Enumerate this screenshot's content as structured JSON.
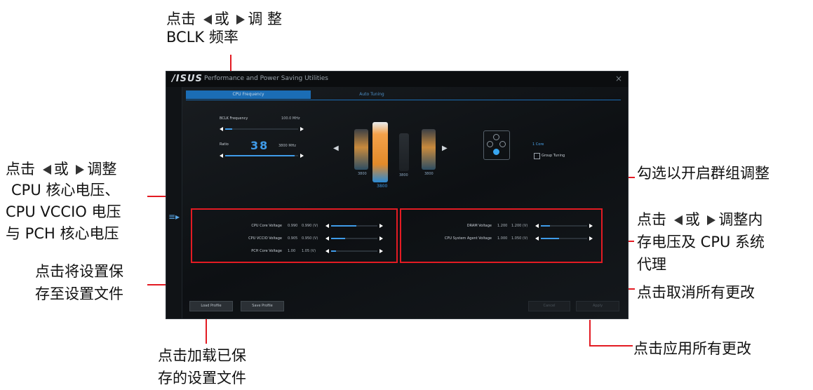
{
  "annotations": {
    "bclk_line1_a": "点击",
    "bclk_line1_b": "或",
    "bclk_line1_c": "调 整",
    "bclk_line2": "BCLK 频率",
    "voltage_line1_a": "点击",
    "voltage_line1_b": "或",
    "voltage_line1_c": "调整",
    "voltage_line2": "CPU 核心电压、",
    "voltage_line3": "CPU VCCIO 电压",
    "voltage_line4": "与 PCH 核心电压",
    "save_line1": "点击将设置保",
    "save_line2": "存至设置文件",
    "load_line1": "点击加载已保",
    "load_line2": "存的设置文件",
    "group": "勾选以开启群组调整",
    "mem_line1_a": "点击",
    "mem_line1_b": "或",
    "mem_line1_c": "调整内",
    "mem_line2": "存电压及  CPU  系统",
    "mem_line3": "代理",
    "cancel": "点击取消所有更改",
    "apply": "点击应用所有更改"
  },
  "window": {
    "logo": "/ISUS",
    "title": "Performance and Power Saving Utilities",
    "close": "×",
    "menu_icon": "≡▸",
    "tabs": [
      "CPU Frequency",
      "Auto Tuning"
    ]
  },
  "frequency": {
    "bclk_label": "BCLK Frequency",
    "bclk_value": "100.0 MHz",
    "ratio_label": "Ratio",
    "ratio_value": "38",
    "ratio_freq": "3800 MHz",
    "bclk_level": 0.1,
    "ratio_level": 0.95
  },
  "cores": {
    "labels": [
      "3800",
      "3800",
      "3800",
      "3800"
    ],
    "left_arrow": "◀",
    "right_arrow": "▶",
    "cores_label": "1 Core",
    "group_label": "Group Tuning"
  },
  "voltages_left": [
    {
      "label": "CPU Core Voltage",
      "v1": "0.990",
      "v2": "0.990 (V)",
      "level": 0.55
    },
    {
      "label": "CPU VCCIO Voltage",
      "v1": "0.905",
      "v2": "0.950 (V)",
      "level": 0.3
    },
    {
      "label": "PCH Core Voltage",
      "v1": "1.00",
      "v2": "1.05 (V)",
      "level": 0.1
    }
  ],
  "voltages_right": [
    {
      "label": "DRAM Voltage",
      "v1": "1.200",
      "v2": "1.200 (V)",
      "level": 0.2
    },
    {
      "label": "CPU System Agent Voltage",
      "v1": "1.000",
      "v2": "1.050 (V)",
      "level": 0.4
    }
  ],
  "buttons": {
    "load": "Load Profile",
    "save": "Save Profile",
    "cancel": "Cancel",
    "apply": "Apply"
  },
  "colors": {
    "accent": "#3f9be8",
    "annotation": "#e31b23"
  }
}
